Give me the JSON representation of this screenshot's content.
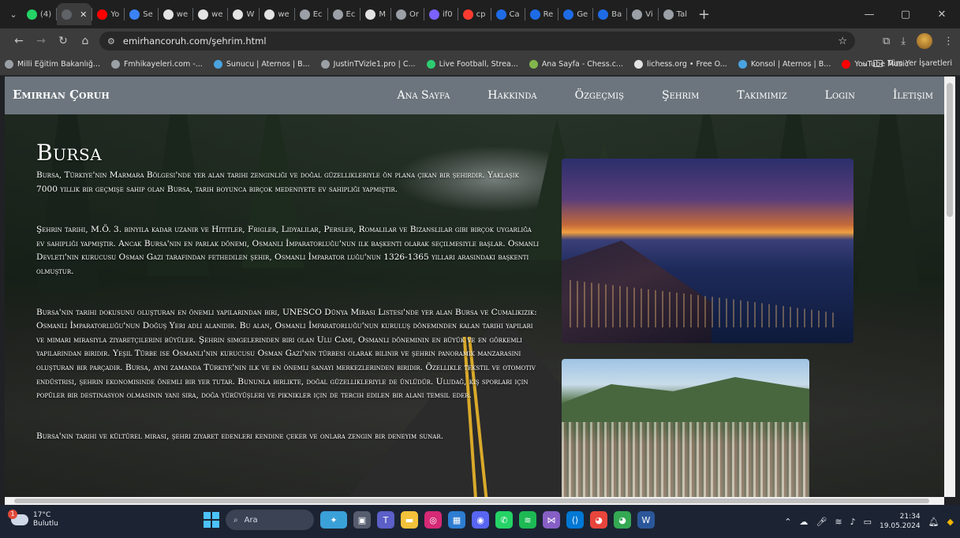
{
  "browser": {
    "tabs": [
      {
        "label": "(4)",
        "color": "#25d366"
      },
      {
        "label": "",
        "color": "#5f6368",
        "active": true
      },
      {
        "label": "Yo",
        "color": "#ff0000"
      },
      {
        "label": "Se",
        "color": "#3b82f6"
      },
      {
        "label": "we",
        "color": "#e3e3e3"
      },
      {
        "label": "we",
        "color": "#e3e3e3"
      },
      {
        "label": "W",
        "color": "#e3e3e3"
      },
      {
        "label": "we",
        "color": "#e3e3e3"
      },
      {
        "label": "Ec",
        "color": "#9aa0a6"
      },
      {
        "label": "Ec",
        "color": "#9aa0a6"
      },
      {
        "label": "M",
        "color": "#e3e3e3"
      },
      {
        "label": "Or",
        "color": "#9aa0a6"
      },
      {
        "label": "if0",
        "color": "#7b61ff"
      },
      {
        "label": "cp",
        "color": "#ff3b30"
      },
      {
        "label": "Ca",
        "color": "#1e6be6"
      },
      {
        "label": "Re",
        "color": "#1e6be6"
      },
      {
        "label": "Ge",
        "color": "#1e6be6"
      },
      {
        "label": "Ba",
        "color": "#1e6be6"
      },
      {
        "label": "Vi",
        "color": "#9aa0a6"
      },
      {
        "label": "Tal",
        "color": "#9aa0a6"
      }
    ],
    "url": "emirhancoruh.com/şehrim.html",
    "bookmarks": [
      {
        "label": "Milli Eğitim Bakanlığ...",
        "color": "#9aa0a6"
      },
      {
        "label": "Fmhikayeleri.com -...",
        "color": "#9aa0a6"
      },
      {
        "label": "Sunucu | Aternos | B...",
        "color": "#4aa3df"
      },
      {
        "label": "JustinTVizle1.pro | C...",
        "color": "#9aa0a6"
      },
      {
        "label": "Live Football, Strea...",
        "color": "#2ecc71"
      },
      {
        "label": "Ana Sayfa - Chess.c...",
        "color": "#81b64c"
      },
      {
        "label": "lichess.org • Free O...",
        "color": "#e3e3e3"
      },
      {
        "label": "Konsol | Aternos | B...",
        "color": "#4aa3df"
      },
      {
        "label": "YouTube Music",
        "color": "#ff0000"
      }
    ],
    "bookmarks_more": "»",
    "all_bookmarks": "Tüm Yer İşaretleri"
  },
  "site": {
    "brand": "Emirhan Çoruh",
    "nav": [
      "Ana Sayfa",
      "Hakkında",
      "Özgeçmiş",
      "Şehrim",
      "Takımımız",
      "Login",
      "İletişim"
    ],
    "title": "Bursa",
    "paragraphs": [
      "Bursa, Türkiye'nin Marmara Bölgesi'nde yer alan tarihi zenginliği ve doğal güzellikleriyle ön plana çıkan bir şehirdir. Yaklaşık 7000 yıllık bir geçmişe sahip olan Bursa, tarih boyunca birçok medeniyete ev sahipliği yapmıştır.",
      "Şehrin tarihi, M.Ö. 3. binyıla kadar uzanır ve Hititler, Frigler, Lidyalılar, Persler, Romalılar ve Bizanslılar gibi birçok uygarlığa ev sahipliği yapmıştır. Ancak Bursa'nın en parlak dönemi, Osmanlı İmparatorluğu'nun ilk başkenti olarak seçilmesiyle başlar. Osmanlı Devleti'nin kurucusu Osman Gazi tarafından fethedilen şehir, Osmanlı İmparator luğu'nun 1326-1365 yılları arasındaki başkenti olmuştur.",
      "Bursa'nın tarihi dokusunu oluşturan en önemli yapılarından biri, UNESCO Dünya Mirası Listesi'nde yer alan Bursa ve Cumalıkızık: Osmanlı İmparatorluğu'nun Doğuş Yeri adlı alanıdır. Bu alan, Osmanlı İmparatorluğu'nun kuruluş döneminden kalan tarihi yapıları ve mimari mirasıyla ziyaretçilerini büyüler. Şehrin simgelerinden biri olan Ulu Cami, Osmanlı döneminin en büyük ve en görkemli yapılarından biridir. Yeşil Türbe ise Osmanlı'nın kurucusu Osman Gazi'nin türbesi olarak bilinir ve şehrin panoramik manzarasını oluşturan bir parçadır. Bursa, aynı zamanda Türkiye'nin ilk ve en önemli sanayi merkezlerinden biridir. Özellikle tekstil ve otomotiv endüstrisi, şehrin ekonomisinde önemli bir yer tutar. Bununla birlikte, doğal güzellikleriyle de ünlüdür. Uludağ, kış sporları için popüler bir destinasyon olmasının yanı sıra, doğa yürüyüşleri ve piknikler için de tercih edilen bir alanı temsil eder.",
      "Bursa'nın tarihi ve kültürel mirası, şehri ziyaret edenleri kendine çeker ve onlara zengin bir deneyim sunar."
    ]
  },
  "taskbar": {
    "weather_badge": "1",
    "temperature": "17°C",
    "condition": "Bulutlu",
    "search_placeholder": "Ara",
    "time": "21:34",
    "date": "19.05.2024"
  }
}
